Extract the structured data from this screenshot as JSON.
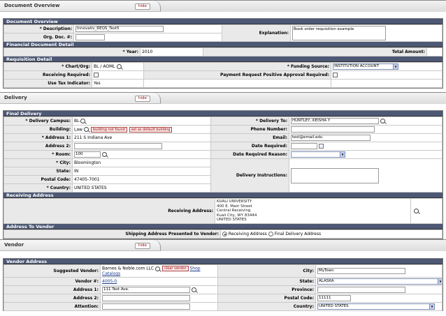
{
  "tabs": {
    "overview": {
      "title": "Document Overview",
      "hide": "hide"
    },
    "delivery": {
      "title": "Delivery",
      "hide": "hide"
    },
    "vendor": {
      "title": "Vendor",
      "hide": "hide"
    }
  },
  "document_overview": {
    "header": "Document Overview",
    "description_label": "* Description:",
    "description_value": "Innovativ_REQS_Test5",
    "org_doc_label": "Org. Doc. #:",
    "org_doc_value": "",
    "explanation_label": "Explanation:",
    "explanation_value": "Book order requisition example"
  },
  "financial": {
    "header": "Financial Document Detail",
    "year_label": "* Year:",
    "year_value": "2010",
    "total_label": "Total Amount:",
    "total_value": ""
  },
  "requisition": {
    "header": "Requisition Detail",
    "chart_org_label": "* Chart/Org:",
    "chart": "BL",
    "slash": "/",
    "org": "AOML",
    "funding_label": "* Funding Source:",
    "funding_value": "INSTITUTION ACCOUNT",
    "receiving_label": "Receiving Required:",
    "payment_label": "Payment Request Positive Approval Required:",
    "usetax_label": "Use Tax Indicator:",
    "usetax_value": "Yes"
  },
  "final_delivery": {
    "header": "Final Delivery",
    "campus_label": "* Delivery Campus:",
    "campus_value": "BL",
    "building_label": "Building:",
    "building_value": "Law",
    "building_not_found": "building not found",
    "set_default": "set as default building",
    "address1_label": "* Address 1:",
    "address1_value": "211 S Indiana Ave",
    "address2_label": "Address 2:",
    "address2_value": "",
    "room_label": "* Room:",
    "room_value": "100",
    "city_label": "* City:",
    "city_value": "Bloomington",
    "state_label": "State:",
    "state_value": "IN",
    "postal_label": "Postal Code:",
    "postal_value": "47405-7001",
    "country_label": "* Country:",
    "country_value": "UNITED STATES",
    "deliver_to_label": "* Delivery To:",
    "deliver_to_value": "HUNTLEY, KEISHA Y",
    "phone_label": "Phone Number:",
    "phone_value": "",
    "email_label": "Email:",
    "email_value": "test@email.edu",
    "date_required_label": "Date Required:",
    "date_required_value": "",
    "date_reason_label": "Date Required Reason:",
    "date_reason_value": "",
    "instructions_label": "Delivery Instructions:",
    "instructions_value": ""
  },
  "receiving_address": {
    "header": "Receiving Address",
    "label": "Receiving Address:",
    "line1": "KUALI UNIVERSITY",
    "line2": "400 E. Main Street",
    "line3": "Central Receiving",
    "line4": "Kuali City,  WY  83444",
    "line5": "UNITED STATES"
  },
  "address_to_vendor": {
    "header": "Address To Vendor",
    "label": "Shipping Address Presented to Vendor:",
    "option_receiving": "Receiving Address",
    "option_final": "Final Delivery Address"
  },
  "vendor_address": {
    "header": "Vendor Address",
    "suggested_label": "Suggested Vendor:",
    "suggested_value": "Barnes & Noble.com LLC",
    "clear_vendor": "clear vendor",
    "shop_catalogs": "Shop Catalogs",
    "vendor_num_label": "Vendor #:",
    "vendor_num_value": "4005-0",
    "address1_label": "Address 1:",
    "address1_value": "111 Test Ave.",
    "address2_label": "Address 2:",
    "address2_value": "",
    "attention_label": "Attention:",
    "attention_value": "",
    "city_label": "City:",
    "city_value": "MyTown",
    "state_label": "State:",
    "state_value": "ALASKA",
    "province_label": "Province:",
    "province_value": "",
    "postal_label": "Postal Code:",
    "postal_value": "11111",
    "country_label": "Country:",
    "country_value": "UNITED STATES"
  },
  "colors": {
    "section_header": "#4d5875",
    "label_bg": "#e9e9e9"
  }
}
